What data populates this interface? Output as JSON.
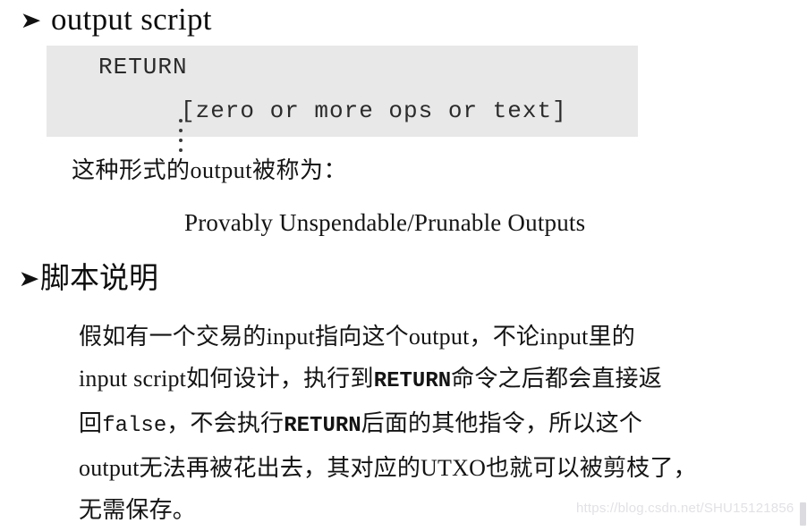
{
  "slide": {
    "background_color": "#ffffff",
    "text_color": "#141414"
  },
  "headings": {
    "bullet_glyph": "➤",
    "output_script": "output script",
    "script_explanation": "脚本说明"
  },
  "code_block": {
    "background_color": "#e8e8e8",
    "opcode": "RETURN",
    "ellipsis_glyph": "⋮",
    "body": "[zero or more ops or text]"
  },
  "body": {
    "called_line": "这种形式的output被称为：",
    "term_line": "Provably Unspendable/Prunable Outputs",
    "paragraph": [
      {
        "parts": [
          {
            "text": "假如有一个交易的input指向这个output，不论input里的",
            "style": "normal"
          }
        ]
      },
      {
        "parts": [
          {
            "text": "input script如何设计，执行到",
            "style": "normal"
          },
          {
            "text": "RETURN",
            "style": "mono-bold"
          },
          {
            "text": "命令之后都会直接返",
            "style": "normal"
          }
        ]
      },
      {
        "parts": [
          {
            "text": "回",
            "style": "normal"
          },
          {
            "text": "false",
            "style": "mono"
          },
          {
            "text": "，不会执行",
            "style": "normal"
          },
          {
            "text": "RETURN",
            "style": "mono-bold"
          },
          {
            "text": "后面的其他指令，所以这个",
            "style": "normal"
          }
        ]
      },
      {
        "parts": [
          {
            "text": "output无法再被花出去，其对应的UTXO也就可以被剪枝了，",
            "style": "normal"
          }
        ]
      },
      {
        "parts": [
          {
            "text": "无需保存。",
            "style": "normal"
          }
        ]
      }
    ]
  },
  "watermark": {
    "text": "https://blog.csdn.net/SHU15121856",
    "color": "#e2e2e6"
  }
}
